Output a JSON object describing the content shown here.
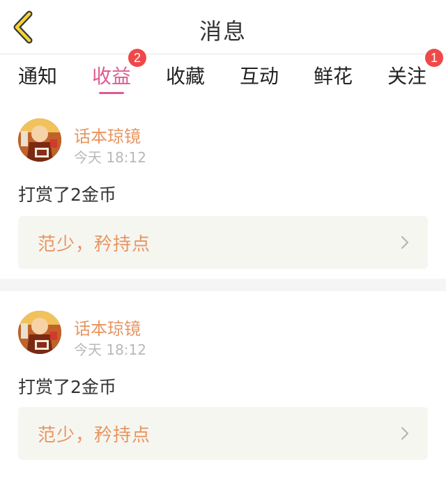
{
  "header": {
    "back_icon": "chevron-left-icon",
    "title": "消息"
  },
  "accent_color": "#e05a91",
  "name_color": "#e89560",
  "badge_color": "#f04848",
  "tabs": [
    {
      "label": "通知",
      "active": false,
      "badge": null
    },
    {
      "label": "收益",
      "active": true,
      "badge": "2"
    },
    {
      "label": "收藏",
      "active": false,
      "badge": null
    },
    {
      "label": "互动",
      "active": false,
      "badge": null
    },
    {
      "label": "鲜花",
      "active": false,
      "badge": null
    },
    {
      "label": "关注",
      "active": false,
      "badge": "1"
    }
  ],
  "messages": [
    {
      "author": "话本琼镜",
      "time": "今天 18:12",
      "text": "打赏了2金币",
      "work_title": "范少，矜持点",
      "chevron_icon": "chevron-right-icon"
    },
    {
      "author": "话本琼镜",
      "time": "今天 18:12",
      "text": "打赏了2金币",
      "work_title": "范少，矜持点",
      "chevron_icon": "chevron-right-icon"
    }
  ]
}
